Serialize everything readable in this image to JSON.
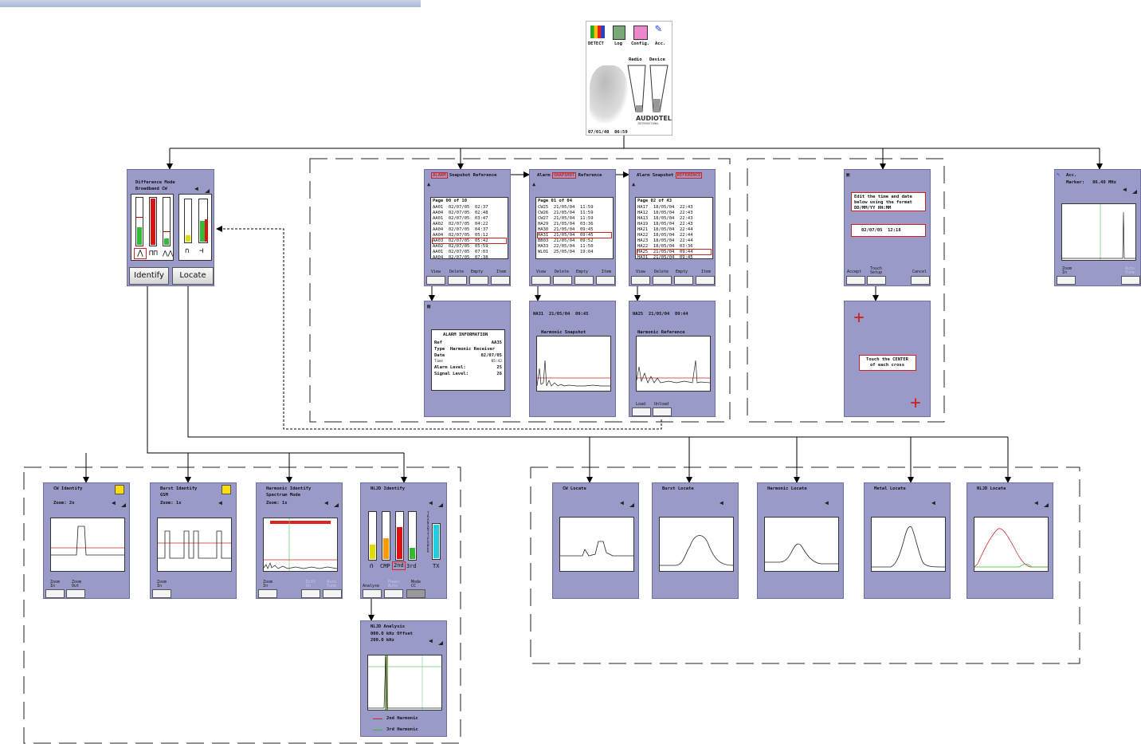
{
  "colors": {
    "screen": "#9a9ac8",
    "accent": "#c22",
    "trace": "#222"
  },
  "main_menu": {
    "icons": [
      "DETECT",
      "Log",
      "Config.",
      "Acc."
    ],
    "bar_labels": [
      "Radio",
      "Device"
    ],
    "brand": "AUDIOTEL",
    "brand_sub": "INTERNATIONAL",
    "datetime": "07/01/40  06:59"
  },
  "difference": {
    "title": "Difference Mode",
    "subtitle": "Broadband CW",
    "buttons": [
      "Identify",
      "Locate"
    ]
  },
  "alarm_ref": {
    "title_tag": "ALARM",
    "title_rest": " Snapshot Reference",
    "page": "Page 00 of 10",
    "rows": [
      "AA01  02/07/05  02:37",
      "AA04  02/07/05  02:48",
      "AA01  02/07/05  03:47",
      "AA02  02/07/05  04:22",
      "AA04  02/07/05  04:37",
      "AA04  02/07/05  05:12",
      "AA03  02/07/05  05:42",
      "AA02  02/07/05  05:59",
      "AA01  02/07/05  07:03",
      "AA04  02/07/05  07:38"
    ],
    "softkeys": [
      "View",
      "Delete",
      "Empty",
      "Item"
    ]
  },
  "snapshot_ref": {
    "title_pre": "Alarm ",
    "title_tag": "SNAPSHOT",
    "title_rest": " Reference",
    "page": "Page 01 of 04",
    "rows": [
      "CW25  21/05/04  11:59",
      "CW26  21/05/04  11:59",
      "CW27  21/05/04  11:59",
      "HA29  21/05/04  03:36",
      "HA30  21/05/04  09:45",
      "HA31  21/05/04  09:45",
      "BB03  21/05/04  09:52",
      "HA33  22/05/04  11:50",
      "WL01  25/05/04  19:04"
    ],
    "softkeys": [
      "View",
      "Delete",
      "Empty",
      "Item"
    ]
  },
  "reference_ref": {
    "title_pre": "Alarm Snapshot ",
    "title_tag": "REFERENCE",
    "page": "Page 02 of 43",
    "rows": [
      "HA17  18/05/04  22:43",
      "HA12  18/05/04  22:43",
      "HA13  18/05/04  22:43",
      "HA19  18/05/04  22:43",
      "HA21  18/05/04  22:44",
      "HA22  18/05/04  22:44",
      "HA23  18/05/04  22:44",
      "HA22  18/05/04  03:36",
      "HA25  21/05/04  09:44",
      "HA31  21/05/04  09:45"
    ],
    "softkeys": [
      "View",
      "Delete",
      "Empty",
      "Item"
    ]
  },
  "alarm_info": {
    "heading": "ALARM INFORMATION",
    "rows": [
      [
        "Ref",
        "AA35"
      ],
      [
        "Type  Harmonic Receiver",
        ""
      ],
      [
        "Date",
        "02/07/05"
      ],
      [
        "Time",
        "05:42"
      ],
      [
        "Alarm Level:",
        "25"
      ],
      [
        "Signal Level:",
        "26"
      ]
    ]
  },
  "harm_snapshot": {
    "header": "HA31  21/05/04  09:45",
    "title": "Harmonic Snapshot"
  },
  "harm_reference": {
    "header": "HA25  21/05/04  09:44",
    "title": "Harmonic Reference",
    "softkeys": [
      "Load",
      "Unload"
    ]
  },
  "time_setup": {
    "instruction": "Edit the time and date\nbelow using the format\nDD/MM/YY HH:MM",
    "value": "02/07/05  12:18",
    "softkeys": [
      "Accept",
      "Touch\nSetup",
      "Cancel"
    ]
  },
  "touch_setup": {
    "instruction": "Touch the CENTER\nof each cross"
  },
  "accessory": {
    "title": "Acc.",
    "marker": "Marker:   86.40 MHz",
    "softkeys": [
      "Zoom\nIn",
      "Auto\nTune"
    ]
  },
  "cw_identify": {
    "title": "CW Identify",
    "zoom": "Zoom: 2x",
    "softkeys": [
      "Zoom\nIn",
      "Zoom\nOut"
    ]
  },
  "burst_identify": {
    "title": "Burst Identify",
    "sub": "GSM",
    "zoom": "Zoom: 1x",
    "softkeys": [
      "Zoom\nIn"
    ]
  },
  "harmonic_identify": {
    "title": "Harmonic Identify",
    "sub": "Spectrum Mode",
    "zoom": "Zoom: 1x",
    "softkeys": [
      "Zoom\nIn",
      "Diff\nOn",
      "Auto\nTune"
    ]
  },
  "nljd_identify": {
    "title": "NLJD Identify",
    "labels": [
      "CMP",
      "2nd",
      "3rd"
    ],
    "side_label": "TRANSMIT POWER",
    "tx": "TX",
    "softkeys": [
      "Analyse",
      "Power\nAuto",
      "Mode\nCC"
    ]
  },
  "nljd_analysis": {
    "title": "NLJD Analysis",
    "offset": "000.0 kHz Offset",
    "span": "200.0 kHz",
    "legend": [
      "2nd Harmonic",
      "3rd Harmonic"
    ]
  },
  "locate": {
    "titles": [
      "CW Locate",
      "Burst Locate",
      "Harmonic Locate",
      "Metal Locate",
      "NLJD Locate"
    ]
  }
}
